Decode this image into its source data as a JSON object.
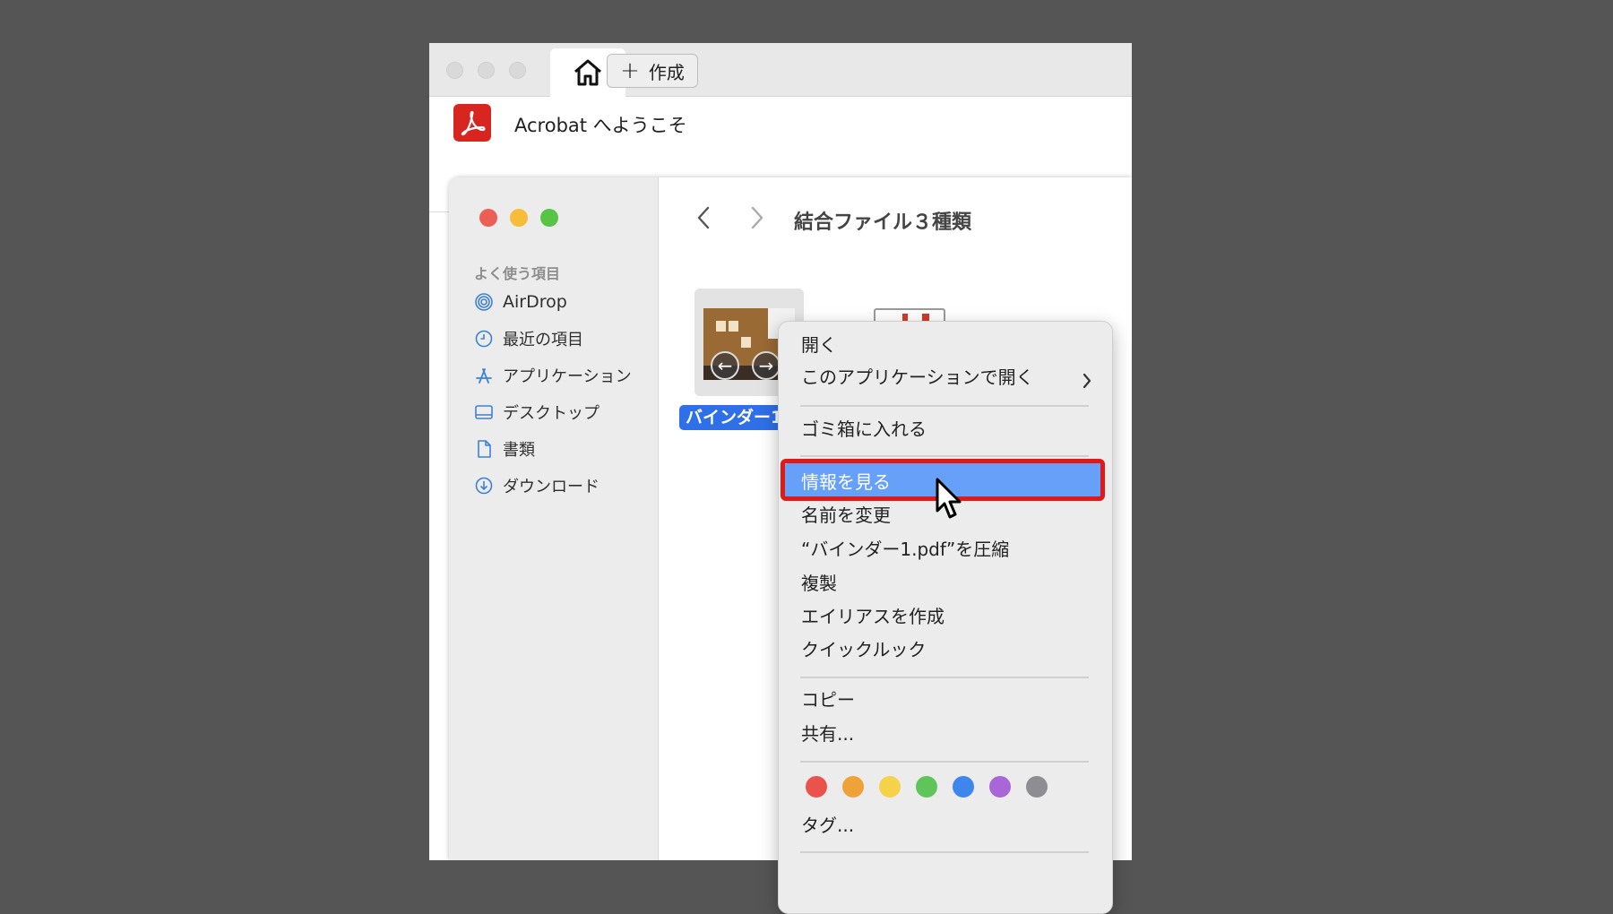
{
  "acrobat": {
    "tab_create_label": "作成",
    "title": "Acrobat へようこそ"
  },
  "finder": {
    "folder_title": "結合ファイル３種類",
    "sidebar": {
      "heading": "よく使う項目",
      "items": [
        "AirDrop",
        "最近の項目",
        "アプリケーション",
        "デスクトップ",
        "書類",
        "ダウンロード"
      ]
    },
    "file_label": "バインダー1"
  },
  "context_menu": {
    "items": {
      "open": "開く",
      "open_with": "このアプリケーションで開く",
      "trash": "ゴミ箱に入れる",
      "get_info": "情報を見る",
      "rename": "名前を変更",
      "compress": "“バインダー1.pdf”を圧縮",
      "duplicate": "複製",
      "make_alias": "エイリアスを作成",
      "quick_look": "クイックルック",
      "copy": "コピー",
      "share": "共有...",
      "tags": "タグ..."
    },
    "tag_colors": [
      "#e9534b",
      "#f0a23a",
      "#f5d24a",
      "#5fc55a",
      "#3f86ec",
      "#a966d6",
      "#8d8d92"
    ]
  },
  "colors": {
    "highlight": "#66a0f8",
    "annotation_box": "#e01919",
    "acrobat_red": "#d7261f",
    "selection_blue": "#2f6fe8"
  }
}
